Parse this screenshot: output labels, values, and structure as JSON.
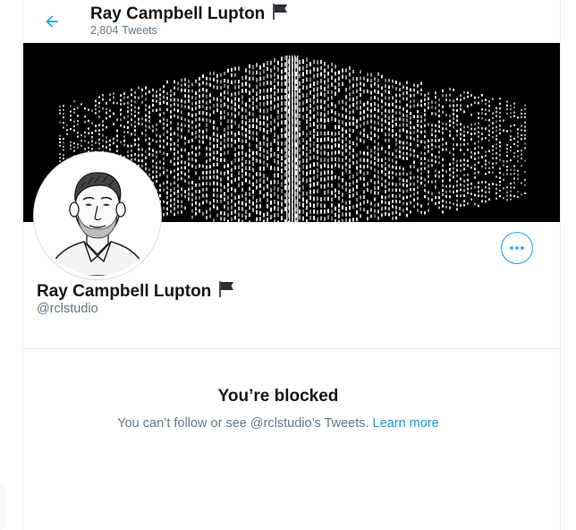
{
  "header": {
    "name": "Ray Campbell Lupton",
    "tweet_count": "2,804",
    "tweet_label": "Tweets"
  },
  "profile": {
    "name": "Ray Campbell Lupton",
    "handle": "@rclstudio"
  },
  "blocked": {
    "title": "You’re blocked",
    "message": "You can’t follow or see @rclstudio’s Tweets.",
    "link": "Learn more"
  },
  "icons": {
    "back": "arrow-left-icon",
    "flag": "black-flag-emoji",
    "more": "more-horizontal-icon"
  },
  "colors": {
    "accent": "#1da1f2",
    "link": "#1b95e0",
    "secondary_text": "#657786",
    "banner_bg": "#000000"
  }
}
